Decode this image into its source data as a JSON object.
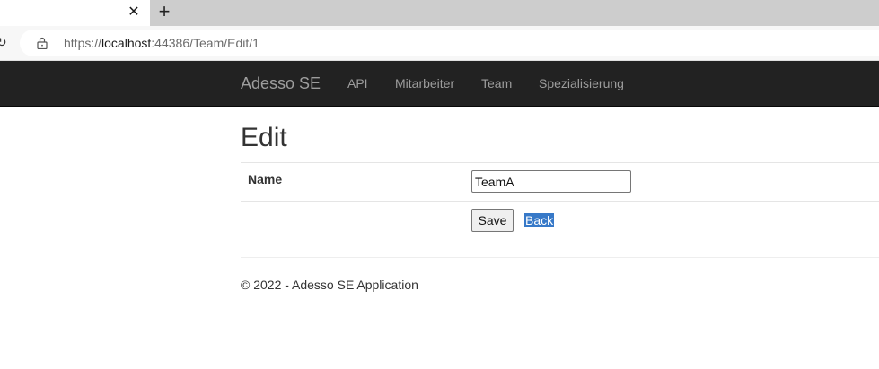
{
  "browser": {
    "tab_close_glyph": "✕",
    "new_tab_glyph": "+",
    "url_prefix": "https://",
    "url_host": "localhost",
    "url_path": ":44386/Team/Edit/1"
  },
  "navbar": {
    "brand": "Adesso SE",
    "links": [
      "API",
      "Mitarbeiter",
      "Team",
      "Spezialisierung"
    ]
  },
  "page": {
    "title": "Edit",
    "name_label": "Name",
    "name_value": "TeamA",
    "save_label": "Save",
    "back_label": "Back"
  },
  "footer": {
    "text": "© 2022 - Adesso SE Application"
  },
  "colors": {
    "navbar_bg": "#222222",
    "nav_text": "#9d9d9d",
    "selection_highlight": "#3779c8"
  }
}
